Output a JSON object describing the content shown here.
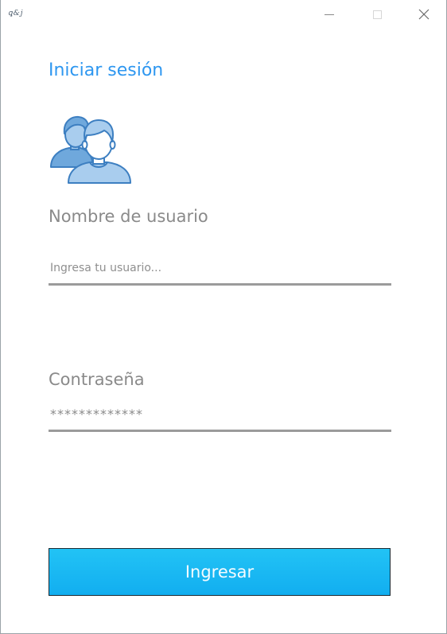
{
  "window": {
    "app_icon_text": "ꝗ&j"
  },
  "heading": "Iniciar sesión",
  "username": {
    "label": "Nombre de usuario",
    "placeholder": "Ingresa tu usuario...",
    "value": ""
  },
  "password": {
    "label": "Contraseña",
    "value": "*************"
  },
  "submit_label": "Ingresar",
  "icons": {
    "users": "users-icon",
    "minimize": "minimize-icon",
    "maximize": "maximize-icon",
    "close": "close-icon"
  },
  "colors": {
    "accent": "#2e97f0",
    "button": "#12aef0",
    "label": "#8a8a8a",
    "underline": "#9b9b9b"
  }
}
